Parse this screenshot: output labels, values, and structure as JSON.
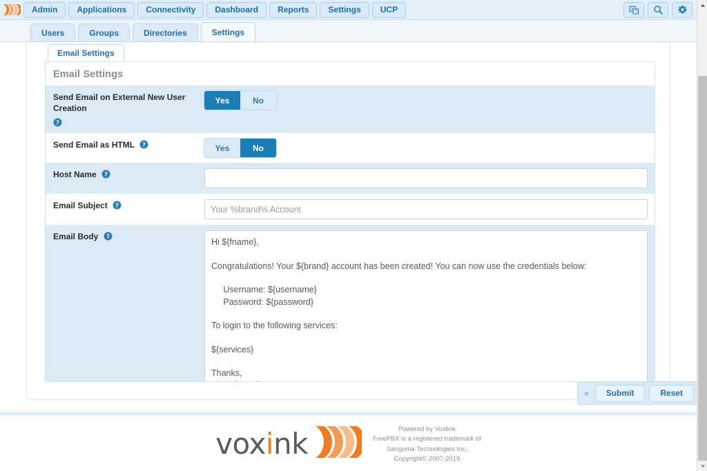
{
  "brand": {
    "mark_icon": "voxlink-waves-icon",
    "accent_color": "#f47b20",
    "primary_blue": "#1b7db5"
  },
  "topnav": {
    "items": [
      {
        "label": "Admin",
        "icon": "nav-admin"
      },
      {
        "label": "Applications",
        "icon": "nav-applications"
      },
      {
        "label": "Connectivity",
        "icon": "nav-connectivity"
      },
      {
        "label": "Dashboard",
        "icon": "nav-dashboard"
      },
      {
        "label": "Reports",
        "icon": "nav-reports"
      },
      {
        "label": "Settings",
        "icon": "nav-settings"
      },
      {
        "label": "UCP",
        "icon": "nav-ucp"
      }
    ],
    "right_icons": [
      {
        "name": "translate-icon",
        "title": "Language"
      },
      {
        "name": "search-icon",
        "title": "Search"
      },
      {
        "name": "gear-icon",
        "title": "Settings"
      }
    ]
  },
  "subtabs": [
    {
      "label": "Users",
      "active": false
    },
    {
      "label": "Groups",
      "active": false
    },
    {
      "label": "Directories",
      "active": false
    },
    {
      "label": "Settings",
      "active": true
    }
  ],
  "inner_tabs": [
    {
      "label": "Email Settings",
      "active": true
    }
  ],
  "panel": {
    "heading": "Email Settings"
  },
  "form": {
    "rows": [
      {
        "label": "Send Email on External New User Creation",
        "help_icon": "help-circle-icon",
        "help_position": "below",
        "type": "toggle",
        "options": [
          "Yes",
          "No"
        ],
        "selected": "Yes",
        "striped": true
      },
      {
        "label": "Send Email as HTML",
        "help_icon": "help-circle-icon",
        "help_position": "inline",
        "type": "toggle",
        "options": [
          "Yes",
          "No"
        ],
        "selected": "No",
        "striped": false
      },
      {
        "label": "Host Name",
        "help_icon": "help-circle-icon",
        "help_position": "inline",
        "type": "text",
        "value": "",
        "placeholder": "",
        "striped": true
      },
      {
        "label": "Email Subject",
        "help_icon": "help-circle-icon",
        "help_position": "inline",
        "type": "text",
        "value": "",
        "placeholder": "Your %brand% Account",
        "striped": false
      },
      {
        "label": "Email Body",
        "help_icon": "help-circle-icon",
        "help_position": "inline",
        "type": "textarea",
        "value": "Hi ${fname},\n\nCongratulations! Your ${brand} account has been created! You can now use the credentials below:\n\n     Username: ${username}\n     Password: ${password}\n\nTo login to the following services:\n\n${services}\n\nThanks,\nThe ${brand} Team",
        "striped": true
      }
    ]
  },
  "actions": {
    "handle_glyph": "»",
    "submit_label": "Submit",
    "reset_label": "Reset"
  },
  "footer": {
    "wordmark_pre": "vox",
    "wordmark_i": "i",
    "wordmark_post": "nk",
    "logo_icon": "voxlink-waves-icon",
    "lines": [
      "Powered by Voxlink",
      "FreePBX is a registered trademark of",
      "Sangoma Technologies Inc.",
      "Copyright© 2007-2019"
    ]
  },
  "scrollbar": {
    "up_glyph": "▲",
    "down_glyph": "▼"
  }
}
